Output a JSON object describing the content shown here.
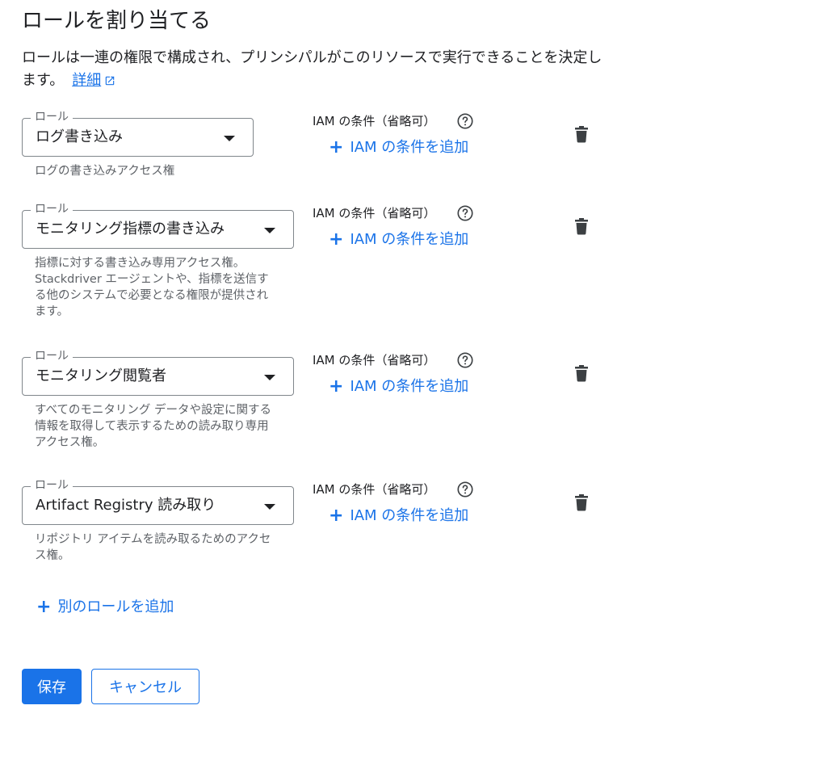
{
  "title": "ロールを割り当てる",
  "description": {
    "text": "ロールは一連の権限で構成され、プリンシパルがこのリソースで実行できることを決定します。",
    "link_label": "詳細"
  },
  "field_label": "ロール",
  "condition": {
    "label": "IAM の条件（省略可）",
    "add_label": "IAM の条件を追加"
  },
  "roles": [
    {
      "value": "ログ書き込み",
      "helper": "ログの書き込みアクセス権"
    },
    {
      "value": "モニタリング指標の書き込み",
      "helper": "指標に対する書き込み専用アクセス権。Stackdriver エージェントや、指標を送信する他のシステムで必要となる権限が提供されます。"
    },
    {
      "value": "モニタリング閲覧者",
      "helper": "すべてのモニタリング データや設定に関する情報を取得して表示するための読み取り専用アクセス権。"
    },
    {
      "value": "Artifact Registry 読み取り",
      "helper": "リポジトリ アイテムを読み取るためのアクセス権。"
    }
  ],
  "add_role_label": "別のロールを追加",
  "buttons": {
    "save": "保存",
    "cancel": "キャンセル"
  },
  "colors": {
    "accent": "#1a73e8",
    "text": "#202124",
    "secondary_text": "#5f6368"
  },
  "icons": {
    "help": "help-circle-icon",
    "delete": "trash-icon",
    "external": "open-in-new-icon",
    "dropdown": "arrow-drop-down-icon",
    "add": "plus-icon"
  }
}
